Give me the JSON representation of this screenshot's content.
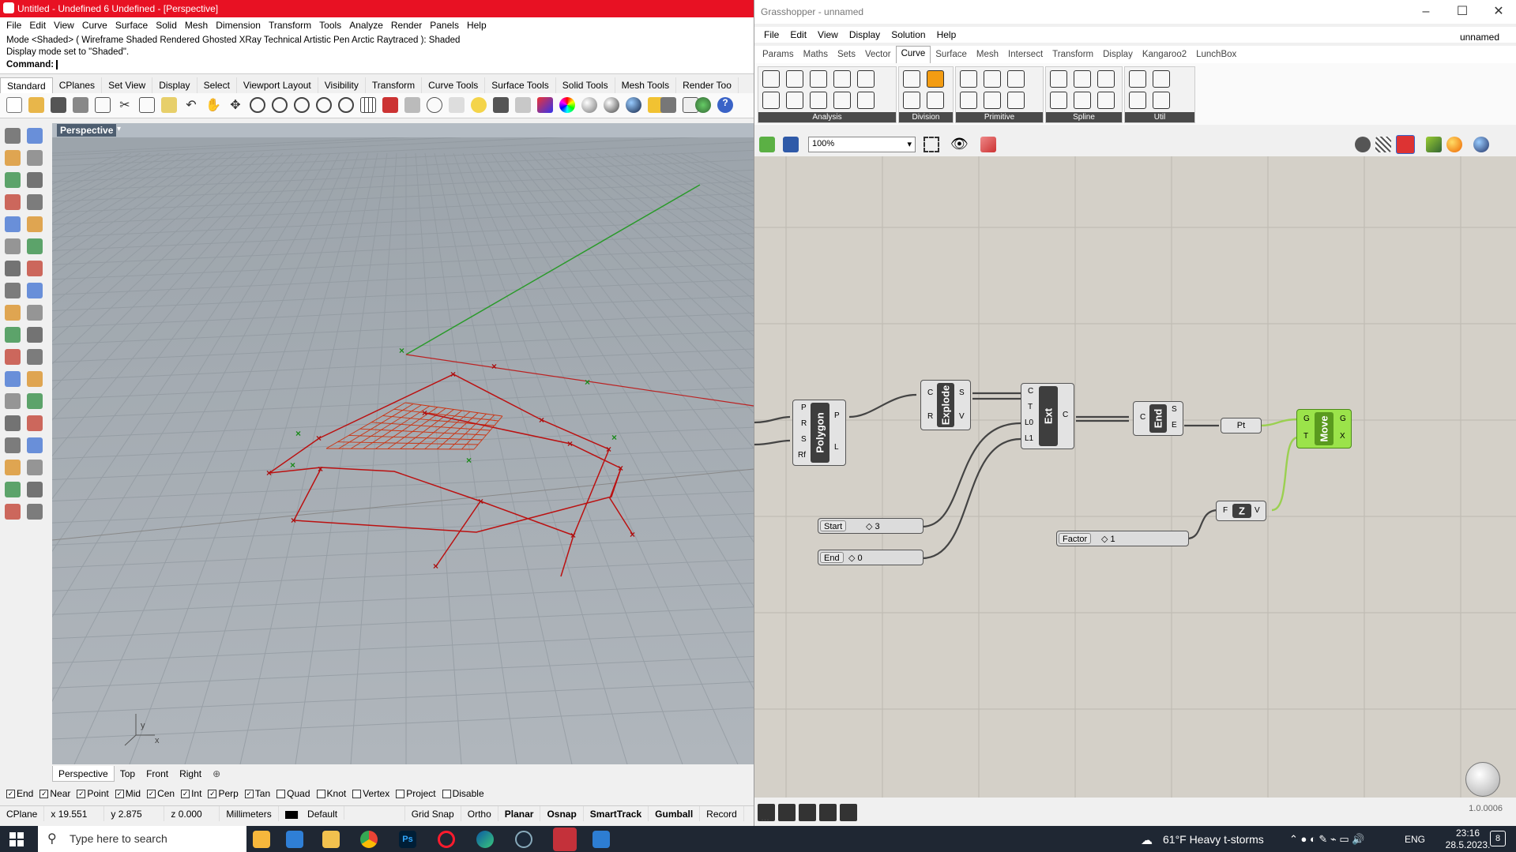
{
  "rhino": {
    "title": "Untitled - Undefined 6 Undefined - [Perspective]",
    "menu": [
      "File",
      "Edit",
      "View",
      "Curve",
      "Surface",
      "Solid",
      "Mesh",
      "Dimension",
      "Transform",
      "Tools",
      "Analyze",
      "Render",
      "Panels",
      "Help"
    ],
    "cmd_history": [
      "Mode <Shaded> ( Wireframe  Shaded  Rendered  Ghosted  XRay  Technical  Artistic  Pen  Arctic  Raytraced ): Shaded",
      "Display mode set to \"Shaded\"."
    ],
    "cmd_prompt": "Command:",
    "tabs": [
      "Standard",
      "CPlanes",
      "Set View",
      "Display",
      "Select",
      "Viewport Layout",
      "Visibility",
      "Transform",
      "Curve Tools",
      "Surface Tools",
      "Solid Tools",
      "Mesh Tools",
      "Render Too"
    ],
    "viewport_title": "Perspective",
    "viewport_tabs": [
      "Perspective",
      "Top",
      "Front",
      "Right"
    ],
    "axis_labels": {
      "y": "y",
      "x": "x"
    },
    "osnaps": [
      {
        "label": "End",
        "checked": true
      },
      {
        "label": "Near",
        "checked": true
      },
      {
        "label": "Point",
        "checked": true
      },
      {
        "label": "Mid",
        "checked": true
      },
      {
        "label": "Cen",
        "checked": true
      },
      {
        "label": "Int",
        "checked": true
      },
      {
        "label": "Perp",
        "checked": true
      },
      {
        "label": "Tan",
        "checked": true
      },
      {
        "label": "Quad",
        "checked": false
      },
      {
        "label": "Knot",
        "checked": false
      },
      {
        "label": "Vertex",
        "checked": false
      },
      {
        "label": "Project",
        "checked": false
      },
      {
        "label": "Disable",
        "checked": false
      }
    ],
    "status": {
      "cplane": "CPlane",
      "x": "x 19.551",
      "y": "y 2.875",
      "z": "z 0.000",
      "units": "Millimeters",
      "layer": "Default",
      "grid_snap": "Grid Snap",
      "ortho": "Ortho",
      "planar": "Planar",
      "osnap": "Osnap",
      "smarttrack": "SmartTrack",
      "gumball": "Gumball",
      "record": "Record"
    }
  },
  "gh": {
    "title": "Grasshopper - unnamed",
    "menu": [
      "File",
      "Edit",
      "View",
      "Display",
      "Solution",
      "Help"
    ],
    "doc_name": "unnamed",
    "tabs": [
      "Params",
      "Maths",
      "Sets",
      "Vector",
      "Curve",
      "Surface",
      "Mesh",
      "Intersect",
      "Transform",
      "Display",
      "Kangaroo2",
      "LunchBox"
    ],
    "active_tab": "Curve",
    "groups": [
      "Analysis",
      "Division",
      "Primitive",
      "Spline",
      "Util"
    ],
    "zoom": "100%",
    "version": "1.0.0006",
    "nodes": {
      "polygon": {
        "name": "Polygon",
        "inputs": [
          "P",
          "R",
          "S",
          "Rf"
        ],
        "outputs": [
          "P",
          "L"
        ]
      },
      "explode": {
        "name": "Explode",
        "inputs": [
          "C",
          "R"
        ],
        "outputs": [
          "S",
          "V"
        ]
      },
      "ext": {
        "name": "Ext",
        "inputs": [
          "C",
          "T",
          "L0",
          "L1"
        ],
        "outputs": [
          "C"
        ]
      },
      "end": {
        "name": "End",
        "inputs": [
          "C"
        ],
        "outputs": [
          "S",
          "E"
        ]
      },
      "pt": {
        "name": "Pt"
      },
      "move": {
        "name": "Move",
        "inputs": [
          "G",
          "T"
        ],
        "outputs": [
          "G",
          "X"
        ]
      },
      "unitz": {
        "name": "Z",
        "inputs": [
          "F"
        ],
        "outputs": [
          "V"
        ]
      }
    },
    "sliders": [
      {
        "label": "Start",
        "value": "3"
      },
      {
        "label": "End",
        "value": "0"
      },
      {
        "label": "Factor",
        "value": "1"
      }
    ]
  },
  "taskbar": {
    "search_placeholder": "Type here to search",
    "weather": "61°F  Heavy t-storms",
    "lang": "ENG",
    "time": "23:16",
    "date": "28.5.2023.",
    "notifications": "8"
  }
}
